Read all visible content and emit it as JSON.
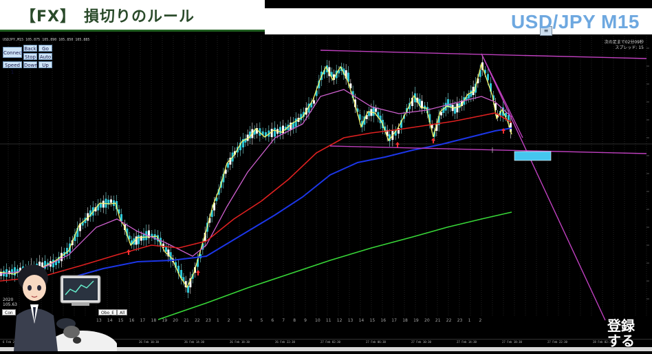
{
  "title_banner": {
    "text": "【FX】　損切りのルール"
  },
  "pair": {
    "label": "USD/JPY M15"
  },
  "chart_header": {
    "symbol_text": "USDJPY,M15  105.875  105.890  105.850  105.885"
  },
  "controls": [
    {
      "label": "Connect"
    },
    {
      "label": "Back"
    },
    {
      "label": "Go"
    },
    {
      "label": "Stop"
    },
    {
      "label": "Auto"
    },
    {
      "label": "Speed 1"
    },
    {
      "label": "Down"
    },
    {
      "label": "Up"
    }
  ],
  "info_top": {
    "line1": "次の足まで02分09秒",
    "line2": "スプレッド: 15"
  },
  "left_info": {
    "line1": "2020",
    "line2": "105.63"
  },
  "mini_buttons": [
    {
      "label": "Con"
    },
    {
      "label": "Obo_E"
    },
    {
      "label": "All"
    }
  ],
  "day_labels": [
    "13",
    "14",
    "15",
    "16",
    "17",
    "18",
    "19",
    "20",
    "21",
    "22",
    "23",
    "1",
    "2",
    "3",
    "4",
    "5",
    "6",
    "7",
    "8",
    "9",
    "10",
    "11",
    "12",
    "13",
    "14",
    "15",
    "16",
    "17",
    "18",
    "19",
    "20",
    "21",
    "22",
    "23",
    "1",
    "2"
  ],
  "time_axis": [
    "6 Feb 2020",
    "26 Feb 02:30",
    "26 Feb 06:30",
    "26 Feb 10:30",
    "26 Feb 14:30",
    "26 Feb 18:30",
    "26 Feb 22:30",
    "27 Feb 02:30",
    "27 Feb 06:30",
    "27 Feb 10:30",
    "27 Feb 14:30",
    "27 Feb 18:30",
    "27 Feb 22:30",
    "28 Feb 02:30"
  ],
  "watermark": {
    "text": "登録\nする"
  },
  "colors": {
    "ma_fast": "#f5f56a",
    "ma_mid": "#d060d0",
    "ma_red": "#e02020",
    "ma_blue": "#1c36e8",
    "ma_green": "#38d838",
    "trendline": "#c040c0",
    "target_box": "#45c6ef"
  },
  "icons": [
    "toolbar-icon",
    "up-arrow-icon"
  ]
}
